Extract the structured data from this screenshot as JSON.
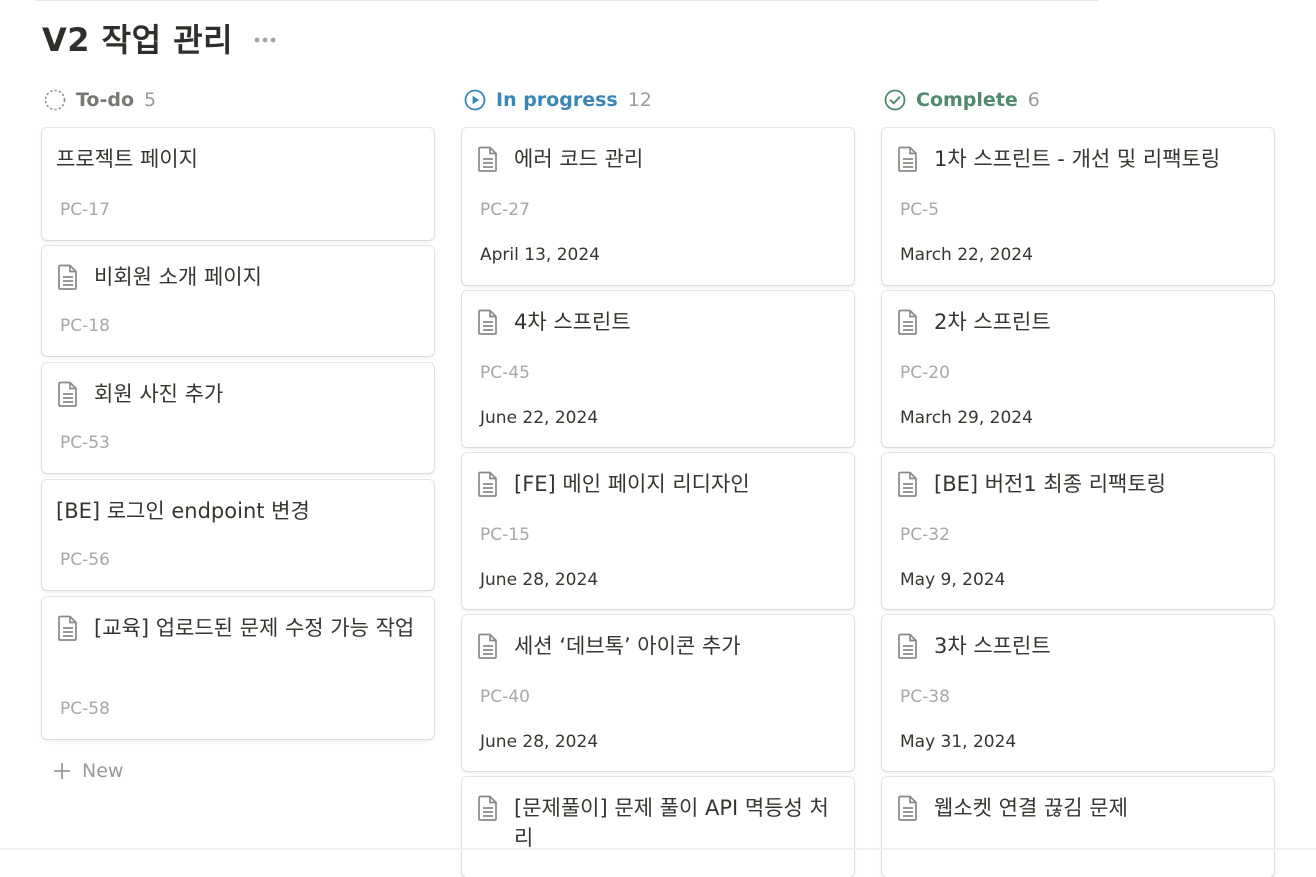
{
  "page": {
    "title": "V2 작업 관리"
  },
  "colors": {
    "todo": "#787774",
    "in_progress": "#3a86b5",
    "complete": "#4f8a6d"
  },
  "columns": [
    {
      "name": "To-do",
      "count": "5",
      "icon": "circle-dashed-icon",
      "cards": [
        {
          "title": "프로젝트 페이지",
          "id": "PC-17",
          "doc_icon": false
        },
        {
          "title": "비회원 소개 페이지",
          "id": "PC-18",
          "doc_icon": true
        },
        {
          "title": "회원 사진 추가",
          "id": "PC-53",
          "doc_icon": true
        },
        {
          "title": "[BE] 로그인 endpoint 변경",
          "id": "PC-56",
          "doc_icon": false
        },
        {
          "title": "[교육] 업로드된 문제 수정 가능 작업",
          "id": "PC-58",
          "doc_icon": true
        }
      ],
      "new_label": "New"
    },
    {
      "name": "In progress",
      "count": "12",
      "icon": "play-circle-icon",
      "cards": [
        {
          "title": "에러 코드 관리",
          "id": "PC-27",
          "date": "April 13, 2024"
        },
        {
          "title": "4차 스프린트",
          "id": "PC-45",
          "date": "June 22, 2024"
        },
        {
          "title": "[FE] 메인 페이지 리디자인",
          "id": "PC-15",
          "date": "June 28, 2024"
        },
        {
          "title": "세션 ‘데브톡’ 아이콘  추가",
          "id": "PC-40",
          "date": "June 28, 2024"
        },
        {
          "title": "[문제풀이] 문제 풀이 API 멱등성 처리"
        }
      ]
    },
    {
      "name": "Complete",
      "count": "6",
      "icon": "check-circle-icon",
      "cards": [
        {
          "title": "1차 스프린트 - 개선 및 리팩토링",
          "id": "PC-5",
          "date": "March 22, 2024"
        },
        {
          "title": "2차 스프린트",
          "id": "PC-20",
          "date": "March 29, 2024"
        },
        {
          "title": "[BE] 버전1 최종 리팩토링",
          "id": "PC-32",
          "date": "May 9, 2024"
        },
        {
          "title": "3차 스프린트",
          "id": "PC-38",
          "date": "May 31, 2024"
        },
        {
          "title": "웹소켓 연결 끊김 문제"
        }
      ]
    }
  ]
}
